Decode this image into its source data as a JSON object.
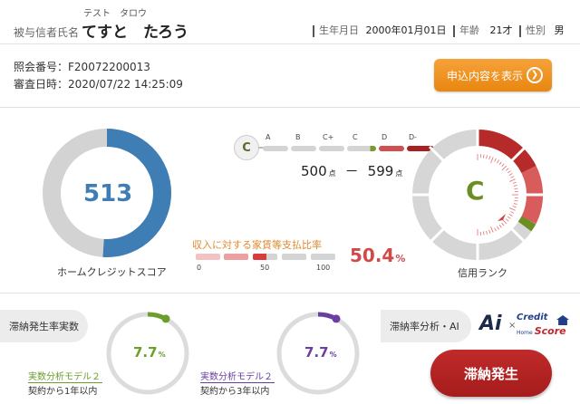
{
  "header": {
    "name_label": "被与信者氏名",
    "name_kana": "テスト　タロウ",
    "name": "てすと　たろう",
    "birth_label": "生年月日",
    "birth_value": "2000年01月01日",
    "age_label": "年齢",
    "age_value": "21才",
    "gender_label": "性別",
    "gender_value": "男"
  },
  "inquiry": {
    "ref_label": "照会番号：",
    "ref_value": "F20072200013",
    "date_label": "審査日時：",
    "date_value": "2020/07/22 14:25:09",
    "show_button_label": "申込内容を表示",
    "show_button_icon": "chevron-right-icon"
  },
  "score": {
    "value": "513",
    "fraction": 0.51,
    "label": "ホームクレジットスコア",
    "color": "#3f7db5"
  },
  "rank_scale": {
    "current_badge": "C",
    "labels": [
      "A",
      "B",
      "C+",
      "C",
      "D",
      "D-"
    ],
    "range_min": "500",
    "range_max": "599",
    "unit": "点",
    "dash": "－"
  },
  "ratio": {
    "label": "収入に対する家賃等支払比率",
    "value": "50.4",
    "unit": "%",
    "ticks": [
      "0",
      "50",
      "100"
    ],
    "color": "#d04a4a"
  },
  "credit_rank": {
    "value": "C",
    "label": "信用ランク",
    "color": "#6b8e23"
  },
  "delinquency": {
    "rate_tag": "滞納発生率実数",
    "model1": {
      "name": "実数分析モデル２",
      "period": "契約から1年以内",
      "value": "7.7",
      "unit": "%",
      "fraction": 0.077,
      "color": "#6b9e2a"
    },
    "model2": {
      "name": "実数分析モデル２",
      "period": "契約から3年以内",
      "value": "7.7",
      "unit": "%",
      "fraction": 0.077,
      "color": "#6a3fa0"
    },
    "ai_tag": "滞納率分析・AI",
    "ai_logo": "Ai",
    "times": "×",
    "credit_logo_line1": "Credit",
    "credit_logo_line2": "Score",
    "credit_logo_small": "Home",
    "result_button": "滞納発生"
  }
}
